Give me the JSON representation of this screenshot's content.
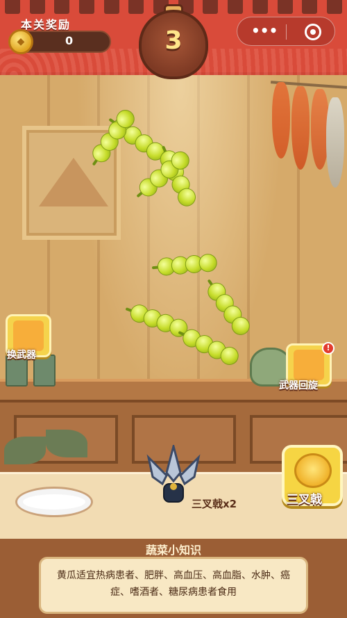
{
  "header": {
    "reward_title": "本关奖励",
    "reward_value": "0",
    "level": "3"
  },
  "capsule": {
    "more_icon": "more-dots-icon",
    "close_icon": "target-icon"
  },
  "weapons": {
    "switch_label": "换武器",
    "return_label": "武器回旋",
    "return_badge": "!",
    "current_label": "三叉戟",
    "current_count": "三叉戟x2"
  },
  "tips": {
    "title": "蔬菜小知识",
    "text": "黄瓜适宜热病患者、肥胖、高血压、高血脂、水肿、癌症、嗜酒者、糖尿病患者食用"
  },
  "pods": [
    {
      "peas": 4,
      "angle": 35
    },
    {
      "peas": 4,
      "angle": -55
    },
    {
      "peas": 4,
      "angle": 65
    },
    {
      "peas": 4,
      "angle": -40
    },
    {
      "peas": 4,
      "angle": -5
    },
    {
      "peas": 4,
      "angle": 55
    },
    {
      "peas": 4,
      "angle": 20
    },
    {
      "peas": 4,
      "angle": 25
    }
  ],
  "colors": {
    "banner": "#d94b3a",
    "pea": "#c6dc2a",
    "button_gold": "#f5d34c"
  }
}
